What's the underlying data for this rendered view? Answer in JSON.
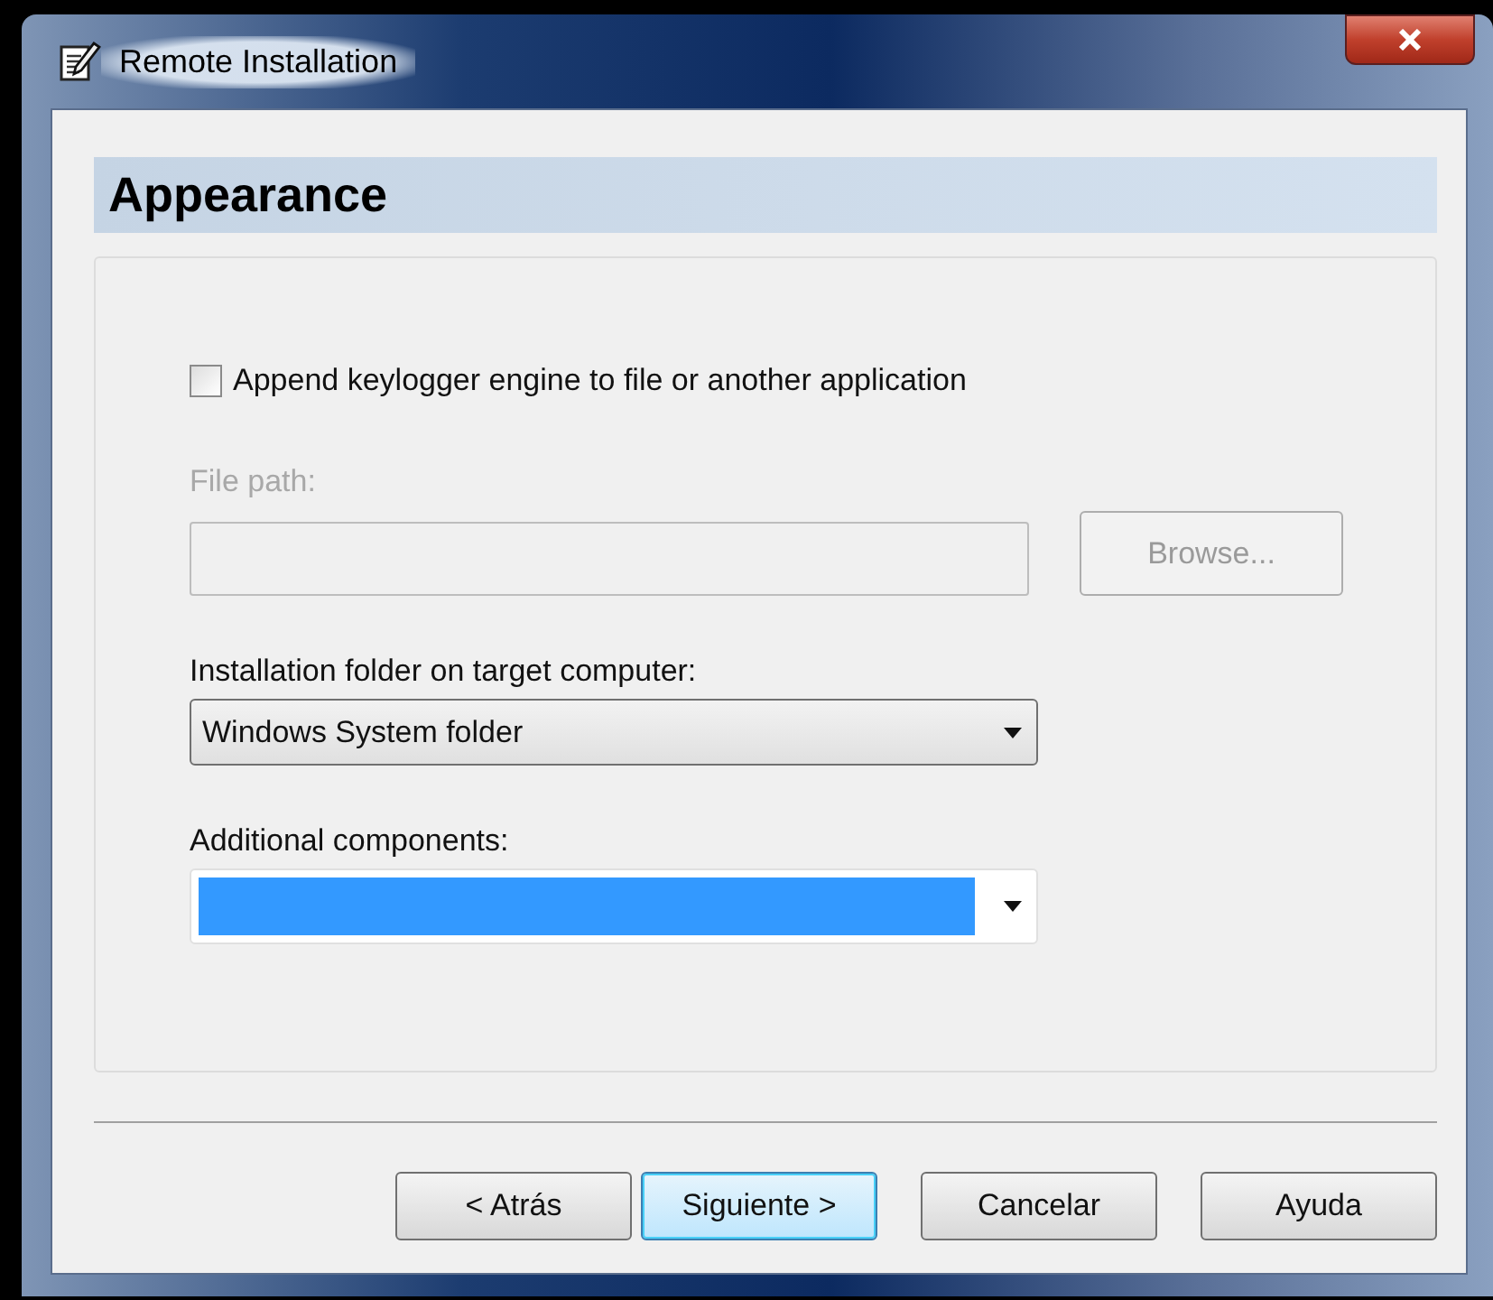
{
  "window": {
    "title": "Remote Installation"
  },
  "header": "Appearance",
  "append_option": {
    "label": "Append keylogger engine to file or another application",
    "checked": false
  },
  "file_path": {
    "label": "File path:",
    "disabled": true
  },
  "browse_button": {
    "label": "Browse...",
    "disabled": true
  },
  "installation_folder": {
    "label": "Installation folder on target computer:",
    "value": "Windows System folder"
  },
  "additional_components": {
    "label": "Additional components:",
    "highlighted": true
  },
  "buttons": [
    {
      "label": "< Atrás",
      "default": false
    },
    {
      "label": "Siguiente >",
      "default": true
    },
    {
      "label": "Cancelar",
      "default": false
    },
    {
      "label": "Ayuda",
      "default": false
    }
  ]
}
